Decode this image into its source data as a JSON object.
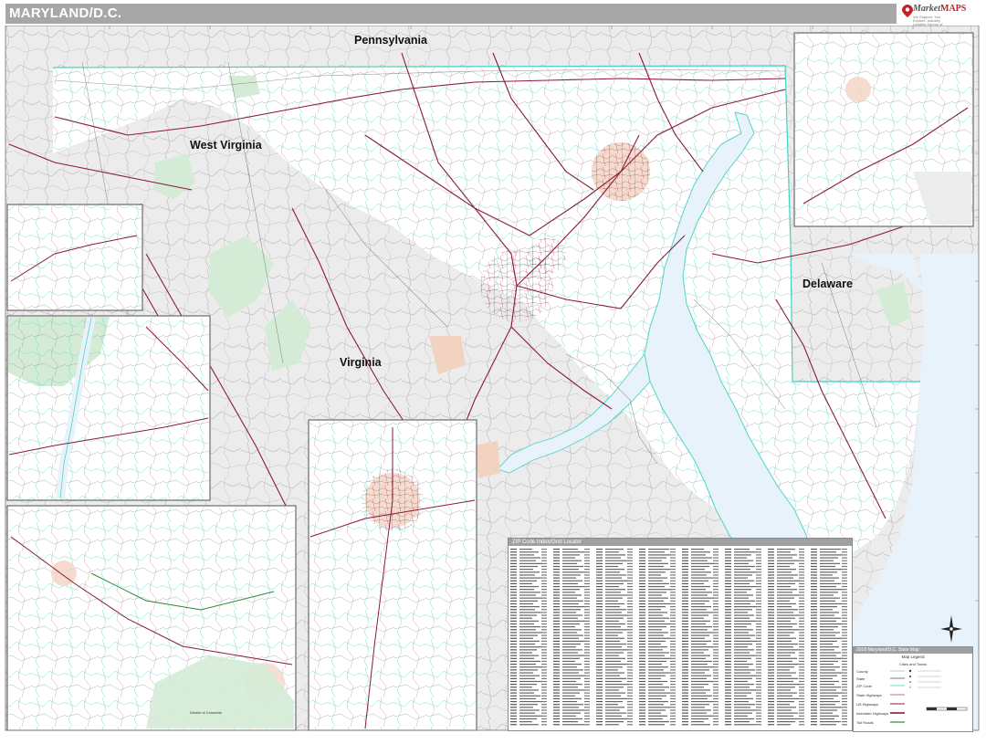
{
  "title": "MARYLAND/D.C.",
  "logo": {
    "brand_pre": "Market",
    "brand_post": "MAPS",
    "tagline": "We Support. You Explore. Industry Leading Source of Business Maps"
  },
  "state_labels": {
    "pennsylvania": "Pennsylvania",
    "west_virginia": "West Virginia",
    "virginia": "Virginia",
    "delaware": "Delaware"
  },
  "inset_labels": {
    "district_of_columbia": "District of Columbia"
  },
  "index": {
    "title": "ZIP Code Index/Grid Locator"
  },
  "legend": {
    "title": "2018 Maryland/D.C. State Map",
    "subtitle": "Map Legend",
    "section": "Cities and Towns",
    "rows": [
      "County",
      "State",
      "ZIP Code",
      "State Highways",
      "US Highways",
      "Interstate Highways",
      "Toll Roads"
    ]
  },
  "colors": {
    "title_bar": "#a7a7a9",
    "water": "#e8f2fb",
    "state_outside": "#ececec",
    "roads_primary": "#8b1a3a",
    "zip_lines": "#3fd9c3",
    "forest": "#d4ecd6",
    "urban": "#f2d3c2"
  }
}
